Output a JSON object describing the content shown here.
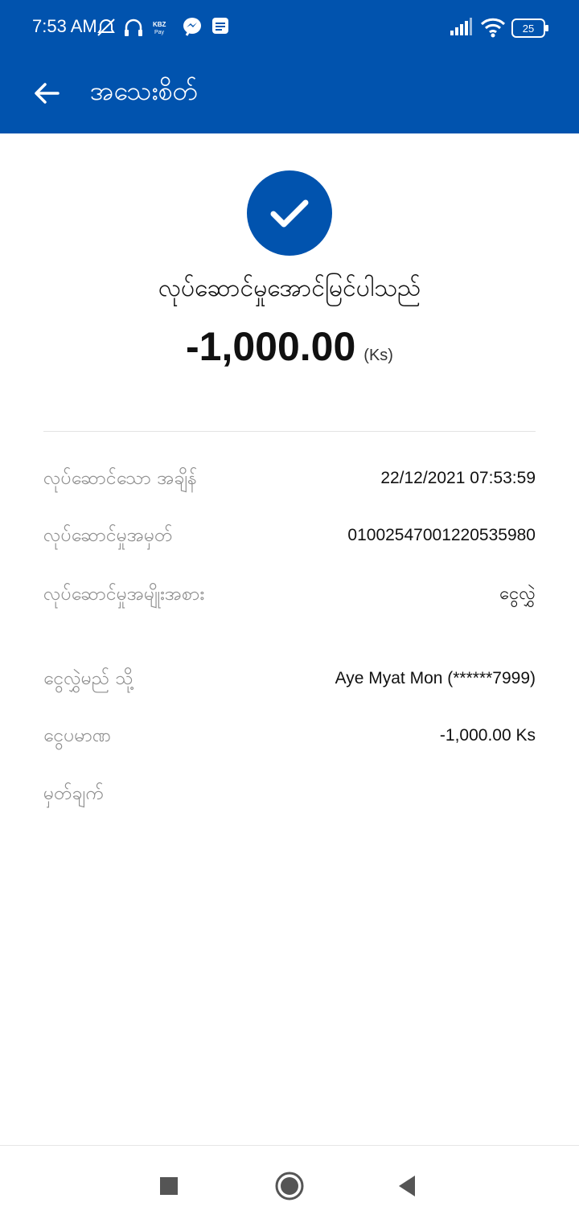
{
  "status_bar": {
    "time": "7:53 AM",
    "battery": "25",
    "icons": [
      "alarm-off-icon",
      "headset-icon",
      "kbzpay-icon",
      "messenger-icon",
      "message-icon",
      "signal-icon",
      "wifi-icon",
      "battery-icon"
    ],
    "kbz_label": "KBZ Pay"
  },
  "header": {
    "title": "အသေးစိတ်",
    "background": "#0153AE"
  },
  "result": {
    "status": "လုပ်ဆောင်မှုအောင်မြင်ပါသည်",
    "amount": "-1,000.00",
    "unit": "(Ks)",
    "accent": "#0153AE"
  },
  "details": [
    {
      "label": "လုပ်ဆောင်သော အချိန်",
      "value": "22/12/2021 07:53:59"
    },
    {
      "label": "လုပ်ဆောင်မှုအမှတ်",
      "value": "010025470012205359​80"
    },
    {
      "label": "လုပ်ဆောင်မှုအမျိုးအစား",
      "value": "ငွေလွှဲ"
    },
    {
      "label": "ငွေလွှဲမည် သို့",
      "value": "Aye Myat Mon (******7999)"
    },
    {
      "label": "ငွေပမာဏ",
      "value": "-1,000.00 Ks"
    },
    {
      "label": "မှတ်ချက်",
      "value": ""
    }
  ],
  "nav": {
    "icons": [
      "recent-apps-icon",
      "home-icon",
      "back-icon"
    ]
  }
}
